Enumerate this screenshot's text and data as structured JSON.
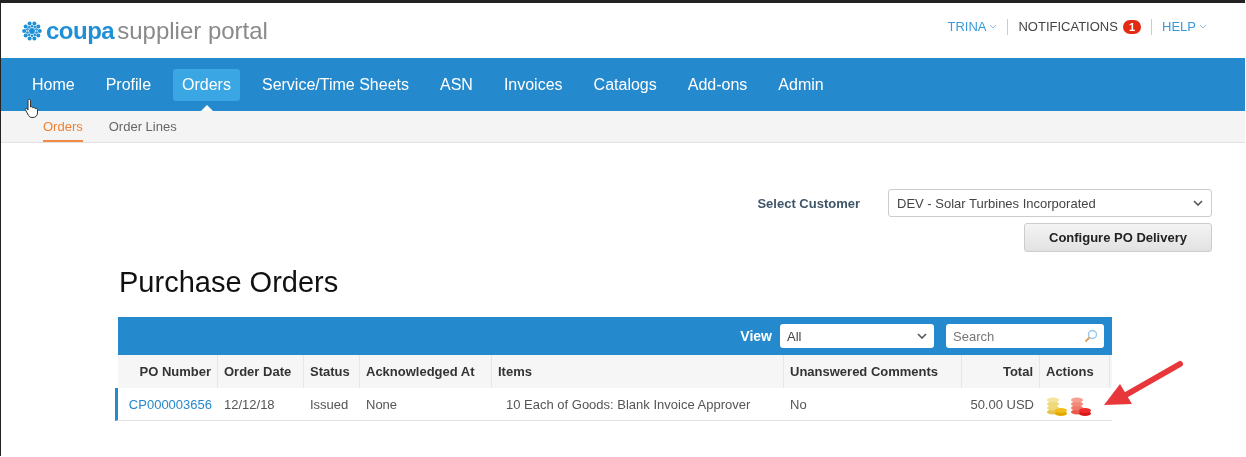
{
  "header": {
    "logo": {
      "brand": "coupa",
      "product": "supplier portal"
    },
    "user_menu": [
      {
        "label": "TRINA",
        "kind": "dropdown"
      },
      {
        "label": "NOTIFICATIONS",
        "kind": "badge",
        "badge": "1"
      },
      {
        "label": "HELP",
        "kind": "dropdown"
      }
    ]
  },
  "nav": [
    {
      "label": "Home",
      "selected": false
    },
    {
      "label": "Profile",
      "selected": false
    },
    {
      "label": "Orders",
      "selected": true
    },
    {
      "label": "Service/Time Sheets",
      "selected": false
    },
    {
      "label": "ASN",
      "selected": false
    },
    {
      "label": "Invoices",
      "selected": false
    },
    {
      "label": "Catalogs",
      "selected": false
    },
    {
      "label": "Add-ons",
      "selected": false
    },
    {
      "label": "Admin",
      "selected": false
    }
  ],
  "subnav": [
    {
      "label": "Orders",
      "selected": true
    },
    {
      "label": "Order Lines",
      "selected": false
    }
  ],
  "customer": {
    "label": "Select Customer",
    "value": "DEV - Solar Turbines Incorporated",
    "button": "Configure PO Delivery"
  },
  "title": "Purchase Orders",
  "table": {
    "view_label": "View",
    "view_value": "All",
    "search": {
      "placeholder": "Search"
    },
    "columns": [
      {
        "label": "PO Number"
      },
      {
        "label": "Order Date"
      },
      {
        "label": "Status"
      },
      {
        "label": "Acknowledged At"
      },
      {
        "label": "Items"
      },
      {
        "label": "Unanswered Comments"
      },
      {
        "label": "Total"
      },
      {
        "label": "Actions"
      }
    ],
    "rows": [
      {
        "highlighted": true,
        "po_number": "CP000003656",
        "order_date": "12/12/18",
        "status": "Issued",
        "acknowledged_at": "None",
        "items": "10 Each of Goods: Blank Invoice Approver",
        "unanswered_comments": "No",
        "total": "50.00 USD"
      }
    ]
  }
}
